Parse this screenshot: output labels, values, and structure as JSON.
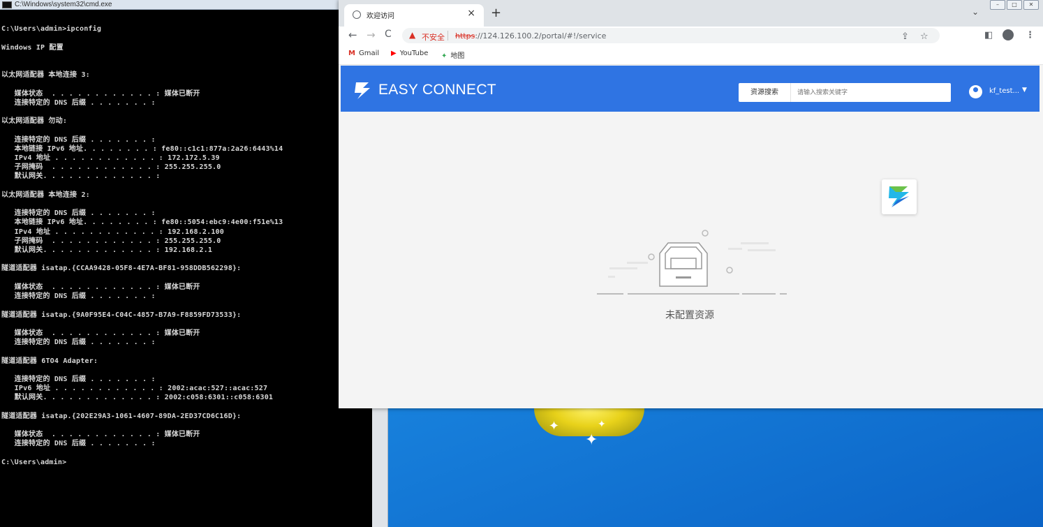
{
  "cmd": {
    "title": "C:\\Windows\\system32\\cmd.exe",
    "lines": [
      "",
      "C:\\Users\\admin>ipconfig",
      "",
      "Windows IP 配置",
      "",
      "",
      "以太网适配器 本地连接 3:",
      "",
      "   媒体状态  . . . . . . . . . . . . : 媒体已断开",
      "   连接特定的 DNS 后缀 . . . . . . . :",
      "",
      "以太网适配器 勿动:",
      "",
      "   连接特定的 DNS 后缀 . . . . . . . :",
      "   本地链接 IPv6 地址. . . . . . . . : fe80::c1c1:877a:2a26:6443%14",
      "   IPv4 地址 . . . . . . . . . . . . : 172.172.5.39",
      "   子网掩码  . . . . . . . . . . . . : 255.255.255.0",
      "   默认网关. . . . . . . . . . . . . :",
      "",
      "以太网适配器 本地连接 2:",
      "",
      "   连接特定的 DNS 后缀 . . . . . . . :",
      "   本地链接 IPv6 地址. . . . . . . . : fe80::5054:ebc9:4e00:f51e%13",
      "   IPv4 地址 . . . . . . . . . . . . : 192.168.2.100",
      "   子网掩码  . . . . . . . . . . . . : 255.255.255.0",
      "   默认网关. . . . . . . . . . . . . : 192.168.2.1",
      "",
      "隧道适配器 isatap.{CCAA9428-05F8-4E7A-BF81-958DDB562298}:",
      "",
      "   媒体状态  . . . . . . . . . . . . : 媒体已断开",
      "   连接特定的 DNS 后缀 . . . . . . . :",
      "",
      "隧道适配器 isatap.{9A0F95E4-C04C-4857-B7A9-F8859FD73533}:",
      "",
      "   媒体状态  . . . . . . . . . . . . : 媒体已断开",
      "   连接特定的 DNS 后缀 . . . . . . . :",
      "",
      "隧道适配器 6TO4 Adapter:",
      "",
      "   连接特定的 DNS 后缀 . . . . . . . :",
      "   IPv6 地址 . . . . . . . . . . . . : 2002:acac:527::acac:527",
      "   默认网关. . . . . . . . . . . . . : 2002:c058:6301::c058:6301",
      "",
      "隧道适配器 isatap.{202E29A3-1061-4607-89DA-2ED37CD6C16D}:",
      "",
      "   媒体状态  . . . . . . . . . . . . : 媒体已断开",
      "   连接特定的 DNS 后缀 . . . . . . . :",
      "",
      "C:\\Users\\admin>"
    ]
  },
  "browser": {
    "tab_title": "欢迎访问",
    "tab_close": "×",
    "new_tab": "+",
    "tab_dropdown": "⌄",
    "security_label": "不安全",
    "url_scheme": "https",
    "url_rest": "://124.126.100.2/portal/#!/service",
    "bookmarks": [
      {
        "label": "Gmail",
        "icon": "gmail-icon",
        "color": "#d93025",
        "glyph": "M"
      },
      {
        "label": "YouTube",
        "icon": "youtube-icon",
        "color": "#ff0000",
        "glyph": "▶"
      },
      {
        "label": "地图",
        "icon": "maps-icon",
        "color": "#34a853",
        "glyph": "✦"
      }
    ]
  },
  "portal": {
    "brand": "EASY CONNECT",
    "search_button": "资源搜索",
    "search_placeholder": "请输入搜索关键字",
    "username": "kf_test...",
    "empty_message": "未配置资源",
    "brand_color": "#2f74e3"
  }
}
